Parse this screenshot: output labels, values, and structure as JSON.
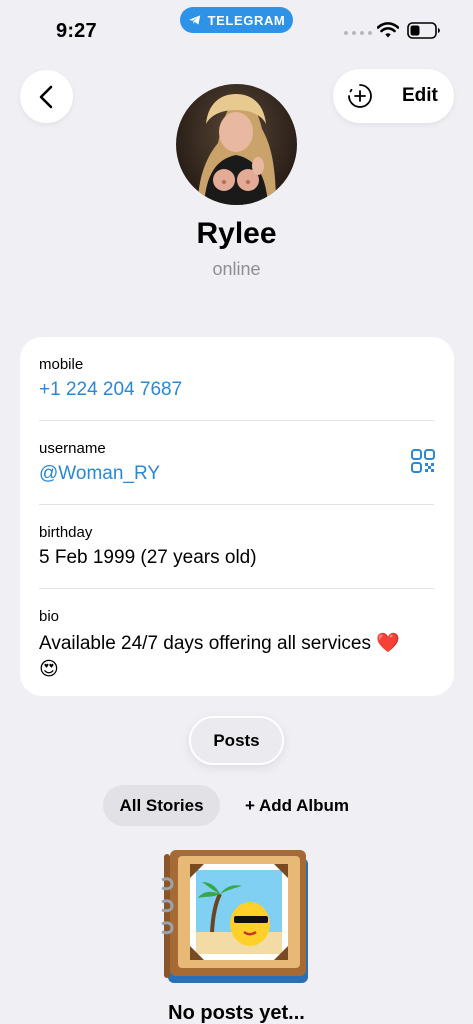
{
  "status_bar": {
    "time": "9:27",
    "app_pill": "TELEGRAM"
  },
  "header": {
    "edit_label": "Edit"
  },
  "profile": {
    "name": "Rylee",
    "status": "online"
  },
  "info": {
    "mobile_label": "mobile",
    "mobile_value": "+1 224 204 7687",
    "username_label": "username",
    "username_value": "@Woman_RY",
    "birthday_label": "birthday",
    "birthday_value": "5 Feb 1999 (27 years old)",
    "bio_label": "bio",
    "bio_text": "Available 24/7 days offering all services",
    "bio_emoji_heart": "❤️",
    "bio_emoji_face": "😍"
  },
  "posts": {
    "tab_label": "Posts",
    "all_stories_label": "All Stories",
    "add_album_label": "+ Add Album",
    "empty_text": "No posts yet..."
  },
  "colors": {
    "accent": "#2a88d4",
    "telegram_blue": "#2e93e6",
    "background": "#efeff4"
  }
}
